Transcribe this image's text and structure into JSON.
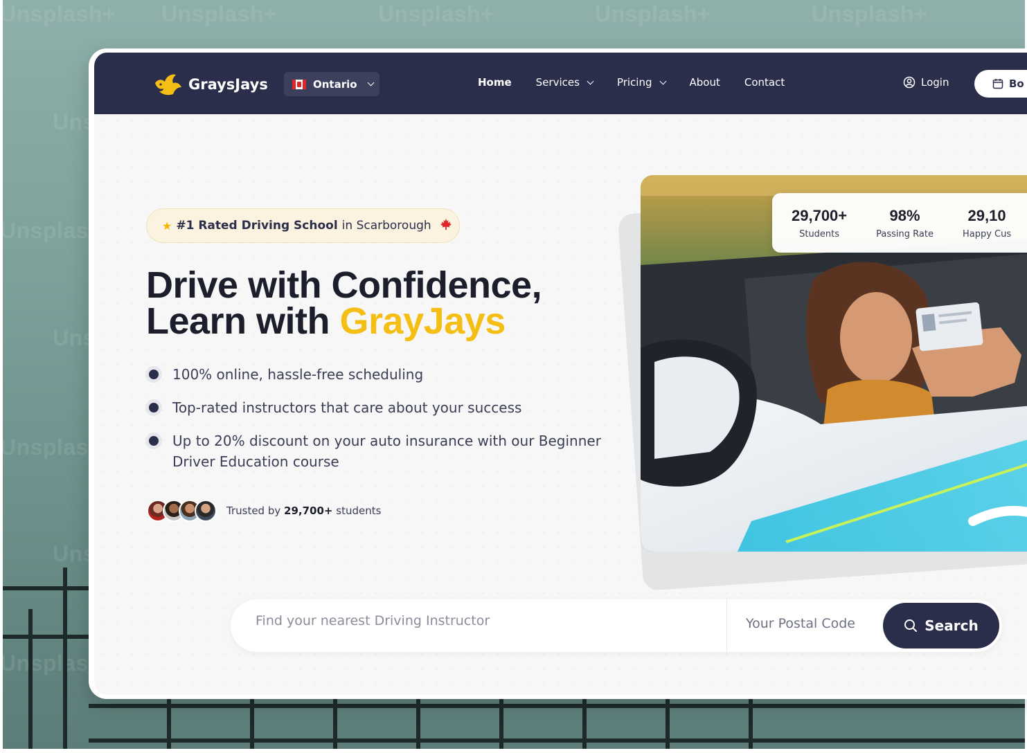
{
  "watermark": "Unsplash+",
  "nav": {
    "logo_text": "GraysJays",
    "region": "Ontario",
    "links": [
      "Home",
      "Services",
      "Pricing",
      "About",
      "Contact"
    ],
    "login": "Login",
    "book": "Bo"
  },
  "hero": {
    "badge_bold": "#1 Rated Driving School",
    "badge_rest": "in Scarborough",
    "title_line1": "Drive with Confidence,",
    "title_line2_prefix": "Learn with ",
    "title_line2_accent": "GrayJays",
    "bullets": [
      "100% online, hassle-free scheduling",
      "Top-rated instructors that care about your success",
      "Up to 20% discount on your auto insurance with our Beginner Driver Education course"
    ],
    "trusted_prefix": "Trusted by",
    "trusted_count": "29,700+",
    "trusted_suffix": "students"
  },
  "stats": [
    {
      "num": "29,700+",
      "label": "Students"
    },
    {
      "num": "98%",
      "label": "Passing Rate"
    },
    {
      "num": "29,10",
      "label": "Happy Cus"
    }
  ],
  "search": {
    "placeholder": "Find your nearest Driving Instructor",
    "postal_placeholder": "Your Postal Code",
    "button": "Search"
  },
  "colors": {
    "navy": "#2b2e4a",
    "accent": "#f5be14"
  }
}
